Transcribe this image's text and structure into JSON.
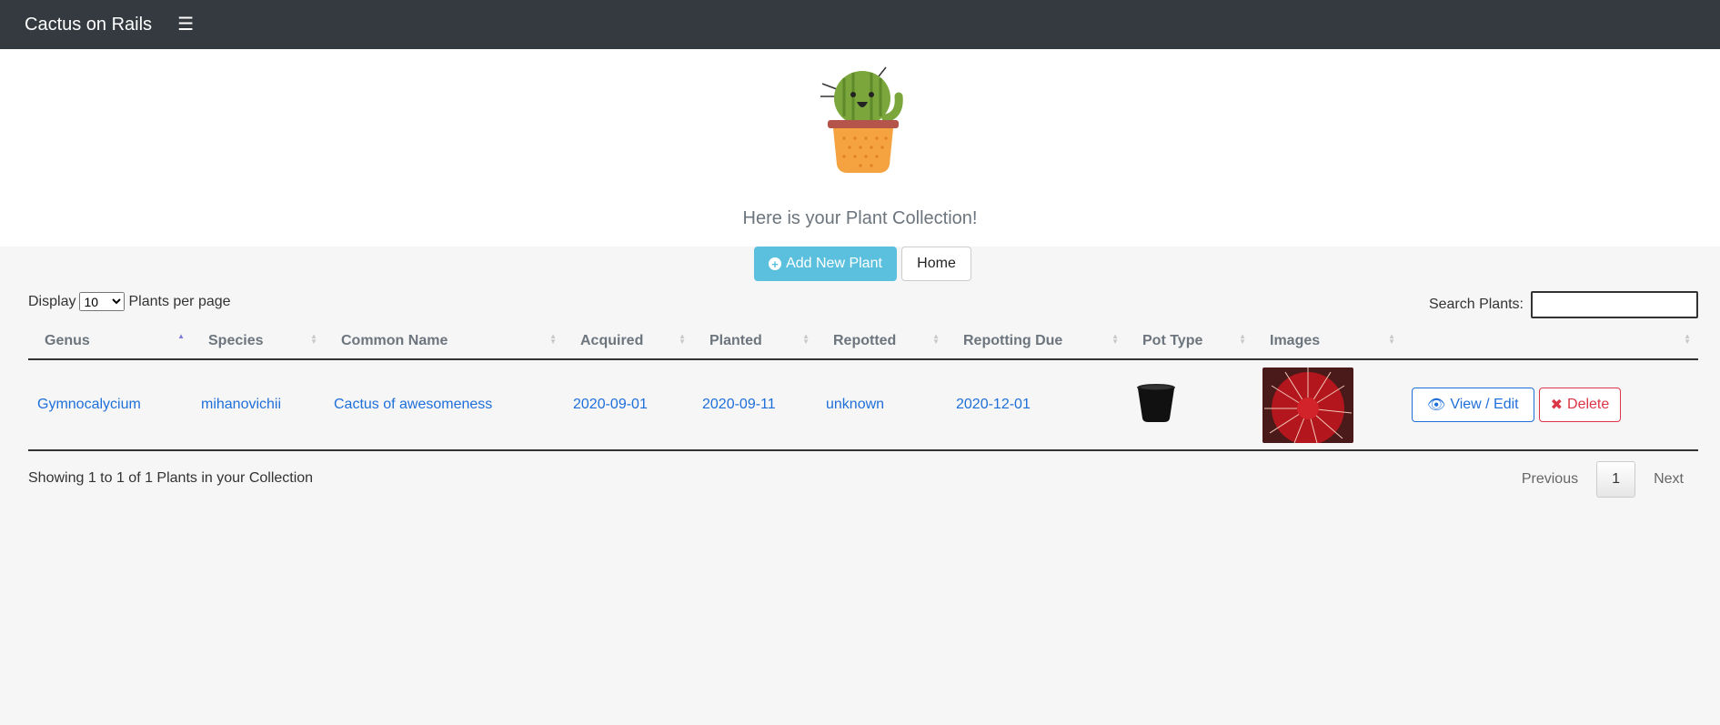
{
  "navbar": {
    "brand": "Cactus on Rails",
    "menu_icon": "hamburger-icon",
    "menu_glyph": "☰"
  },
  "hero": {
    "title": "Here is your Plant Collection!",
    "add_button": "Add New Plant",
    "home_button": "Home"
  },
  "controls": {
    "display_label": "Display",
    "per_page": "10",
    "per_page_suffix": "Plants per page",
    "search_label": "Search Plants:",
    "search_value": ""
  },
  "table": {
    "columns": [
      "Genus",
      "Species",
      "Common Name",
      "Acquired",
      "Planted",
      "Repotted",
      "Repotting Due",
      "Pot Type",
      "Images",
      ""
    ],
    "rows": [
      {
        "genus": "Gymnocalycium",
        "species": "mihanovichii",
        "common_name": "Cactus of awesomeness",
        "acquired": "2020-09-01",
        "planted": "2020-09-11",
        "repotted": "unknown",
        "repotting_due": "2020-12-01",
        "view_label": "View / Edit",
        "delete_label": "Delete"
      }
    ]
  },
  "footer": {
    "info": "Showing 1 to 1 of 1 Plants in your Collection",
    "previous": "Previous",
    "page": "1",
    "next": "Next"
  },
  "colors": {
    "navbar": "#343a40",
    "info_button": "#5bc0de",
    "link": "#1e6fd9",
    "danger": "#dc3545"
  }
}
